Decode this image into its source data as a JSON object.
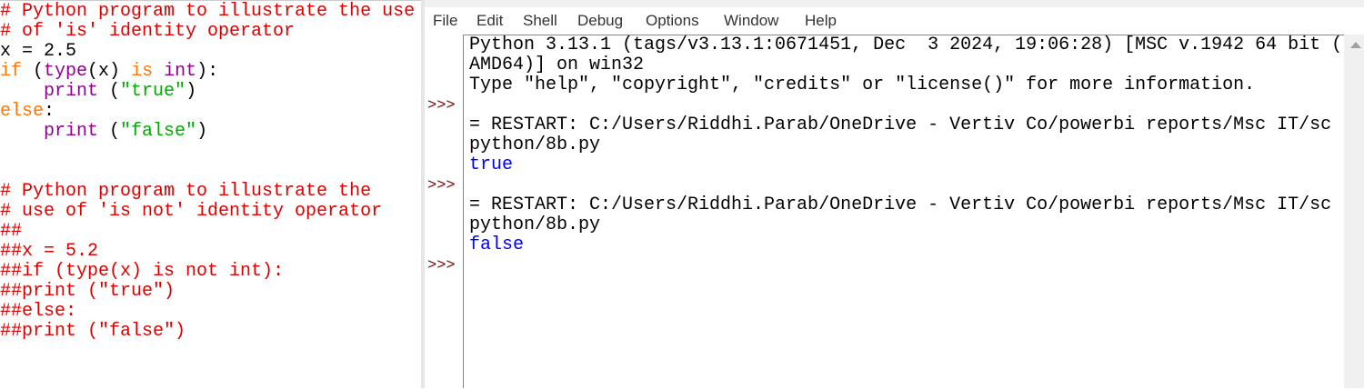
{
  "editor": {
    "lines": [
      [
        {
          "t": "# Python program to illustrate the use",
          "c": "c"
        }
      ],
      [
        {
          "t": "# of 'is' identity operator",
          "c": "c"
        }
      ],
      [
        {
          "t": "x = 2.5",
          "c": ""
        }
      ],
      [
        {
          "t": "if",
          "c": "k"
        },
        {
          "t": " (",
          "c": ""
        },
        {
          "t": "type",
          "c": "b"
        },
        {
          "t": "(x) ",
          "c": ""
        },
        {
          "t": "is",
          "c": "k"
        },
        {
          "t": " ",
          "c": ""
        },
        {
          "t": "int",
          "c": "b"
        },
        {
          "t": "):",
          "c": ""
        }
      ],
      [
        {
          "t": "    ",
          "c": ""
        },
        {
          "t": "print",
          "c": "b"
        },
        {
          "t": " (",
          "c": ""
        },
        {
          "t": "\"true\"",
          "c": "s"
        },
        {
          "t": ")",
          "c": ""
        }
      ],
      [
        {
          "t": "else",
          "c": "k"
        },
        {
          "t": ":",
          "c": ""
        }
      ],
      [
        {
          "t": "    ",
          "c": ""
        },
        {
          "t": "print",
          "c": "b"
        },
        {
          "t": " (",
          "c": ""
        },
        {
          "t": "\"false\"",
          "c": "s"
        },
        {
          "t": ")",
          "c": ""
        }
      ],
      [],
      [],
      [
        {
          "t": "# Python program to illustrate the",
          "c": "c"
        }
      ],
      [
        {
          "t": "# use of 'is not' identity operator",
          "c": "c"
        }
      ],
      [
        {
          "t": "##",
          "c": "c"
        }
      ],
      [
        {
          "t": "##x = 5.2",
          "c": "c"
        }
      ],
      [
        {
          "t": "##if (type(x) is not int):",
          "c": "c"
        }
      ],
      [
        {
          "t": "##print (\"true\")",
          "c": "c"
        }
      ],
      [
        {
          "t": "##else:",
          "c": "c"
        }
      ],
      [
        {
          "t": "##print (\"false\")",
          "c": "c"
        }
      ]
    ]
  },
  "menu": [
    "File",
    "Edit",
    "Shell",
    "Debug",
    "Options",
    "Window",
    "Help"
  ],
  "shell": {
    "prompt": ">>>",
    "lines": [
      {
        "t": "Python 3.13.1 (tags/v3.13.1:0671451, Dec  3 2024, 19:06:28) [MSC v.1942 64 bit (",
        "c": ""
      },
      {
        "t": "AMD64)] on win32",
        "c": ""
      },
      {
        "t": "Type \"help\", \"copyright\", \"credits\" or \"license()\" for more information.",
        "c": ""
      },
      {
        "t": "",
        "c": ""
      },
      {
        "t": "= RESTART: C:/Users/Riddhi.Parab/OneDrive - Vertiv Co/powerbi reports/Msc IT/sc",
        "c": ""
      },
      {
        "t": "python/8b.py",
        "c": ""
      },
      {
        "t": "true",
        "c": "blue"
      },
      {
        "t": "",
        "c": ""
      },
      {
        "t": "= RESTART: C:/Users/Riddhi.Parab/OneDrive - Vertiv Co/powerbi reports/Msc IT/sc",
        "c": ""
      },
      {
        "t": "python/8b.py",
        "c": ""
      },
      {
        "t": "false",
        "c": "blue"
      }
    ]
  }
}
